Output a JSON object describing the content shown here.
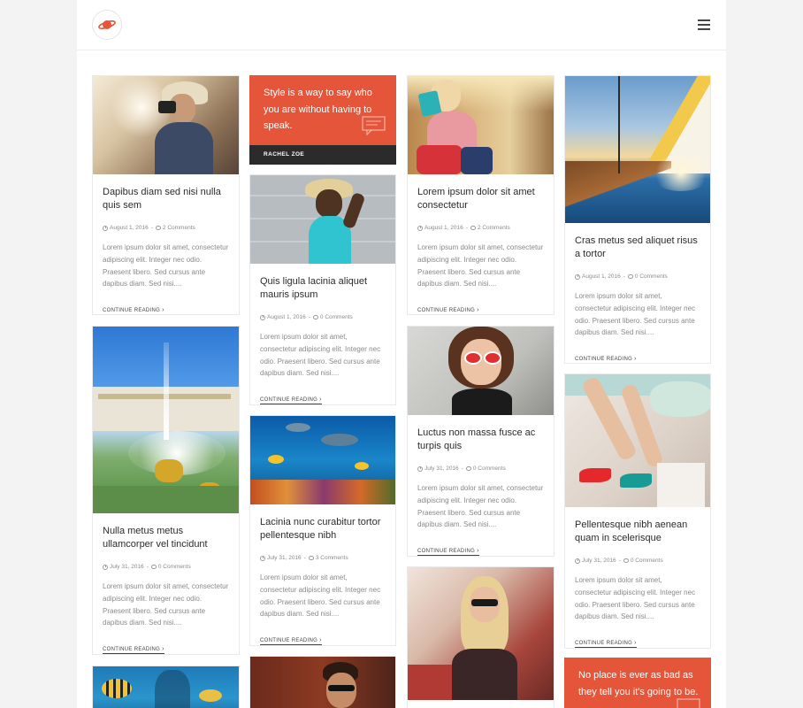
{
  "header": {
    "logo_icon": "planet-icon",
    "menu_icon": "hamburger-menu-icon"
  },
  "colors": {
    "accent": "#e5553a",
    "dark_bar": "#2b2b2b",
    "background": "#f3f3f3"
  },
  "common": {
    "read_more": "CONTINUE READING",
    "excerpt": "Lorem ipsum dolor sit amet, consectetur adipiscing elit. Integer nec odio. Praesent libero. Sed cursus ante dapibus diam. Sed nisi...."
  },
  "posts": [
    {
      "title": "Dapibus diam sed nisi nulla quis sem",
      "date": "August 1, 2016",
      "comments": "2 Comments"
    },
    {
      "title": "Nulla metus metus ullamcorper vel tincidunt",
      "date": "July 31, 2016",
      "comments": "0 Comments"
    },
    {
      "title": "Quis ligula lacinia aliquet mauris ipsum",
      "date": "August 1, 2016",
      "comments": "0 Comments"
    },
    {
      "title": "Lacinia nunc curabitur tortor pellentesque nibh",
      "date": "July 31, 2016",
      "comments": "3 Comments"
    },
    {
      "title": "Lorem ipsum dolor sit amet consectetur",
      "date": "August 1, 2016",
      "comments": "2 Comments"
    },
    {
      "title": "Luctus non massa fusce ac turpis quis",
      "date": "July 31, 2016",
      "comments": "0 Comments"
    },
    {
      "title": "Cras metus sed aliquet risus a tortor",
      "date": "August 1, 2016",
      "comments": "0 Comments"
    },
    {
      "title": "Pellentesque nibh aenean quam in scelerisque",
      "date": "July 31, 2016",
      "comments": "0 Comments"
    }
  ],
  "quotes": [
    {
      "text": "Style is a way to say who you are without having to speak.",
      "author": "RACHEL ZOE"
    },
    {
      "text": "No place is ever as bad as they tell you it's going to be."
    }
  ]
}
